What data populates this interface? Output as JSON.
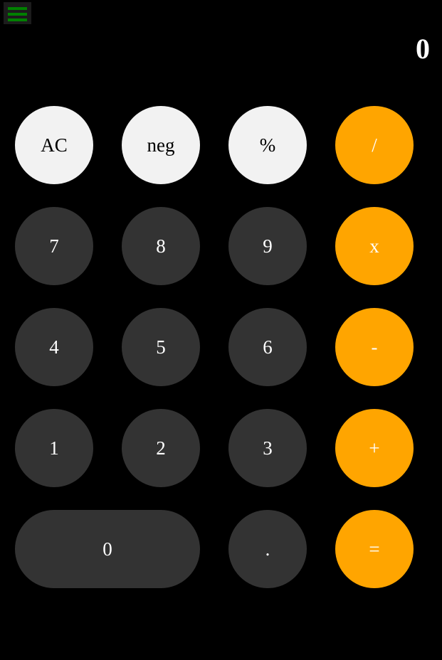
{
  "display": {
    "value": "0"
  },
  "menu": {
    "icon": "hamburger-menu-icon",
    "color": "#008000"
  },
  "colors": {
    "background": "#000000",
    "function_key": "#f2f2f2",
    "digit_key": "#333333",
    "operator_key": "#ffa500"
  },
  "keys": {
    "clear": "AC",
    "negate": "neg",
    "percent": "%",
    "divide": "/",
    "seven": "7",
    "eight": "8",
    "nine": "9",
    "multiply": "x",
    "four": "4",
    "five": "5",
    "six": "6",
    "subtract": "-",
    "one": "1",
    "two": "2",
    "three": "3",
    "add": "+",
    "zero": "0",
    "decimal": ".",
    "equals": "="
  }
}
